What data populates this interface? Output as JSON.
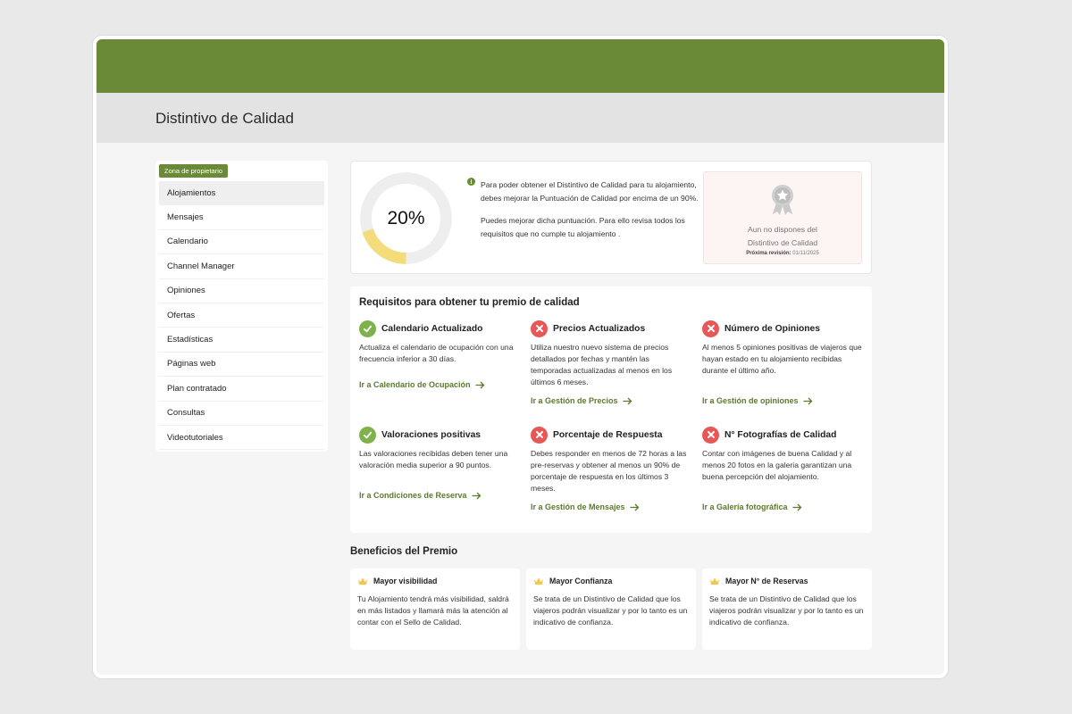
{
  "colors": {
    "brand": "#6b8a37",
    "ok": "#7fb24d",
    "bad": "#e85656",
    "progress": "#f4dc7a",
    "track": "#eeeeee",
    "crown": "#f2c84b"
  },
  "page": {
    "title": "Distintivo de Calidad"
  },
  "sidebar": {
    "badge": "Zona de propietario",
    "items": [
      {
        "label": "Alojamientos",
        "active": true
      },
      {
        "label": "Mensajes"
      },
      {
        "label": "Calendario"
      },
      {
        "label": "Channel Manager"
      },
      {
        "label": "Opiniones"
      },
      {
        "label": "Ofertas"
      },
      {
        "label": "Estadísticas"
      },
      {
        "label": "Páginas web"
      },
      {
        "label": "Plan contratado"
      },
      {
        "label": "Consultas"
      },
      {
        "label": "Videotutoriales"
      }
    ]
  },
  "score": {
    "value": 0.2,
    "label": "20%",
    "info_icon": "info-icon",
    "paragraph1": "Para poder obtener el Distintivo de Calidad para tu alojamiento, debes mejorar la Puntuación de Calidad por encima de un 90%.",
    "paragraph2": "Puedes mejorar dicha puntuación. Para ello revisa todos los requisitos que no cumple tu alojamiento .",
    "award": {
      "icon": "award-medal-icon",
      "title_line1": "Aun no dispones del",
      "title_line2": "Distintivo de Calidad",
      "review_label": "Próxima revisión:",
      "review_date": "01/11/2025"
    }
  },
  "requirements": {
    "title": "Requisitos para obtener tu premio de calidad",
    "items": [
      {
        "name": "Calendario Actualizado",
        "ok": true,
        "desc": "Actualiza el calendario de ocupación con una frecuencia inferior a 30 días.",
        "link": "Ir a Calendario de Ocupación"
      },
      {
        "name": "Precios Actualizados",
        "ok": false,
        "desc": "Utiliza nuestro nuevo sistema de precios detallados por fechas y mantén las temporadas actualizadas al menos en los últimos 6 meses.",
        "link": "Ir a Gestión de Precios"
      },
      {
        "name": "Número de Opiniones",
        "ok": false,
        "desc": "Al menos 5 opiniones positivas de viajeros que hayan estado en tu alojamiento recibidas durante el último año.",
        "link": "Ir a Gestión de opiniones"
      },
      {
        "name": "Valoraciones positivas",
        "ok": true,
        "desc": "Las valoraciones recibidas deben tener una valoración media superior a 90 puntos.",
        "link": "Ir a Condiciones de Reserva"
      },
      {
        "name": "Porcentaje de Respuesta",
        "ok": false,
        "desc": "Debes responder en menos de 72 horas a las pre-reservas y obtener al menos un 90% de porcentaje de respuesta en los últimos 3 meses.",
        "link": "Ir a Gestión de Mensajes"
      },
      {
        "name": "N° Fotografías de Calidad",
        "ok": false,
        "desc": "Contar con imágenes de buena Calidad y al menos 20 fotos en la galeria garantizan una buena percepción del alojamiento.",
        "link": "Ir a Galería fotográfica"
      }
    ]
  },
  "benefits": {
    "title": "Beneficios del Premio",
    "items": [
      {
        "icon": "crown-icon",
        "name": "Mayor visibilidad",
        "desc": "Tu Alojamiento tendrá más visibilidad, saldrá en más listados y llamará más la atención al contar con el Sello de Calidad."
      },
      {
        "icon": "crown-icon",
        "name": "Mayor Confianza",
        "desc": "Se trata de un Distintivo de Calidad que los viajeros podrán visualizar y por lo tanto es un indicativo de confianza."
      },
      {
        "icon": "crown-icon",
        "name": "Mayor N° de Reservas",
        "desc": " Se trata de un Distintivo de Calidad que los viajeros podrán visualizar y por lo tanto es un indicativo de confianza."
      }
    ]
  }
}
